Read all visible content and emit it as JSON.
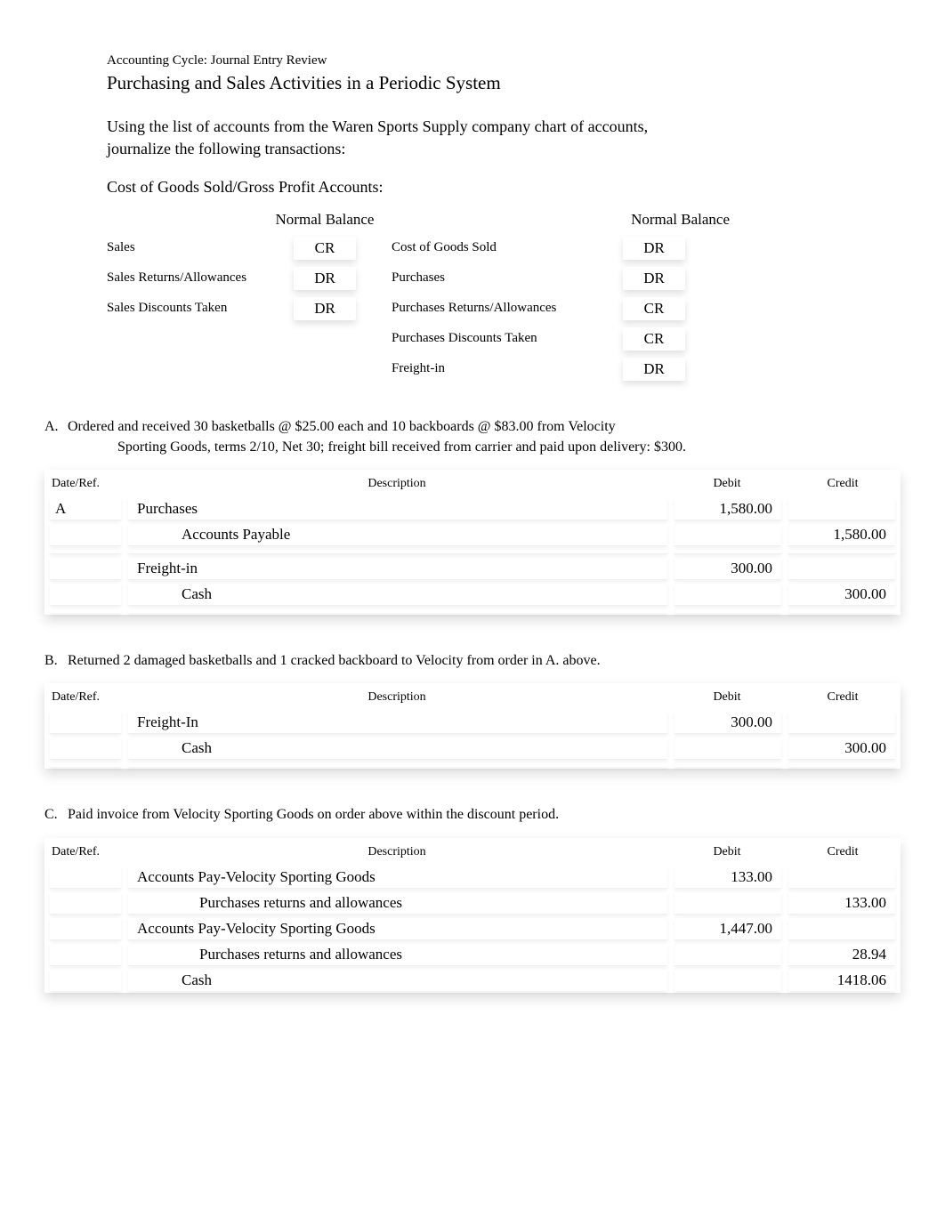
{
  "header": {
    "subtitle": "Accounting Cycle: Journal Entry Review",
    "title": "Purchasing and Sales Activities in a Periodic System",
    "intro": "Using the list of accounts from the Waren Sports Supply company chart of accounts, journalize the following transactions:",
    "cogs_header": "Cost of Goods Sold/Gross Profit Accounts:"
  },
  "accounts": {
    "normal_balance_label": "Normal Balance",
    "left": [
      {
        "name": "Sales",
        "bal": "CR"
      },
      {
        "name": "Sales Returns/Allowances",
        "bal": "DR"
      },
      {
        "name": "Sales Discounts Taken",
        "bal": "DR"
      }
    ],
    "right": [
      {
        "name": "Cost of Goods Sold",
        "bal": "DR"
      },
      {
        "name": "Purchases",
        "bal": "DR"
      },
      {
        "name": "Purchases Returns/Allowances",
        "bal": "CR"
      },
      {
        "name": "Purchases Discounts Taken",
        "bal": "CR"
      },
      {
        "name": "Freight-in",
        "bal": "DR"
      }
    ]
  },
  "journal_headers": {
    "ref": "Date/Ref.",
    "desc": "Description",
    "debit": "Debit",
    "credit": "Credit"
  },
  "sections": [
    {
      "letter": "A.",
      "text_line1": "Ordered and received 30 basketballs @ $25.00 each and 10 backboards @ $83.00 from Velocity",
      "text_line2": "Sporting Goods, terms 2/10, Net 30; freight bill received from carrier and paid upon delivery: $300.",
      "rows": [
        {
          "ref": "A",
          "desc": "Purchases",
          "indent": 0,
          "debit": "1,580.00",
          "credit": ""
        },
        {
          "ref": "",
          "desc": "Accounts Payable",
          "indent": 1,
          "debit": "",
          "credit": "1,580.00"
        },
        {
          "ref": "",
          "desc": "",
          "indent": 0,
          "debit": "",
          "credit": ""
        },
        {
          "ref": "",
          "desc": "Freight-in",
          "indent": 0,
          "debit": "300.00",
          "credit": ""
        },
        {
          "ref": "",
          "desc": "Cash",
          "indent": 1,
          "debit": "",
          "credit": "300.00"
        },
        {
          "ref": "",
          "desc": "",
          "indent": 0,
          "debit": "",
          "credit": ""
        }
      ]
    },
    {
      "letter": "B.",
      "text_line1": "Returned 2 damaged basketballs and 1 cracked backboard to Velocity from order in A. above.",
      "text_line2": "",
      "rows": [
        {
          "ref": "",
          "desc": "Freight-In",
          "indent": 0,
          "debit": "300.00",
          "credit": ""
        },
        {
          "ref": "",
          "desc": "Cash",
          "indent": 1,
          "debit": "",
          "credit": "300.00"
        },
        {
          "ref": "",
          "desc": "",
          "indent": 0,
          "debit": "",
          "credit": ""
        }
      ]
    },
    {
      "letter": "C.",
      "text_line1": "Paid invoice from Velocity Sporting Goods on order above within the discount period.",
      "text_line2": "",
      "rows": [
        {
          "ref": "",
          "desc": "Accounts Pay-Velocity Sporting Goods",
          "indent": 0,
          "debit": "133.00",
          "credit": ""
        },
        {
          "ref": "",
          "desc": "Purchases returns and allowances",
          "indent": 2,
          "debit": "",
          "credit": "133.00"
        },
        {
          "ref": "",
          "desc": "Accounts Pay-Velocity Sporting Goods",
          "indent": 0,
          "debit": "1,447.00",
          "credit": ""
        },
        {
          "ref": "",
          "desc": "Purchases returns and allowances",
          "indent": 2,
          "debit": "",
          "credit": "28.94"
        },
        {
          "ref": "",
          "desc": "Cash",
          "indent": 1,
          "debit": "",
          "credit": "1418.06"
        }
      ]
    }
  ]
}
